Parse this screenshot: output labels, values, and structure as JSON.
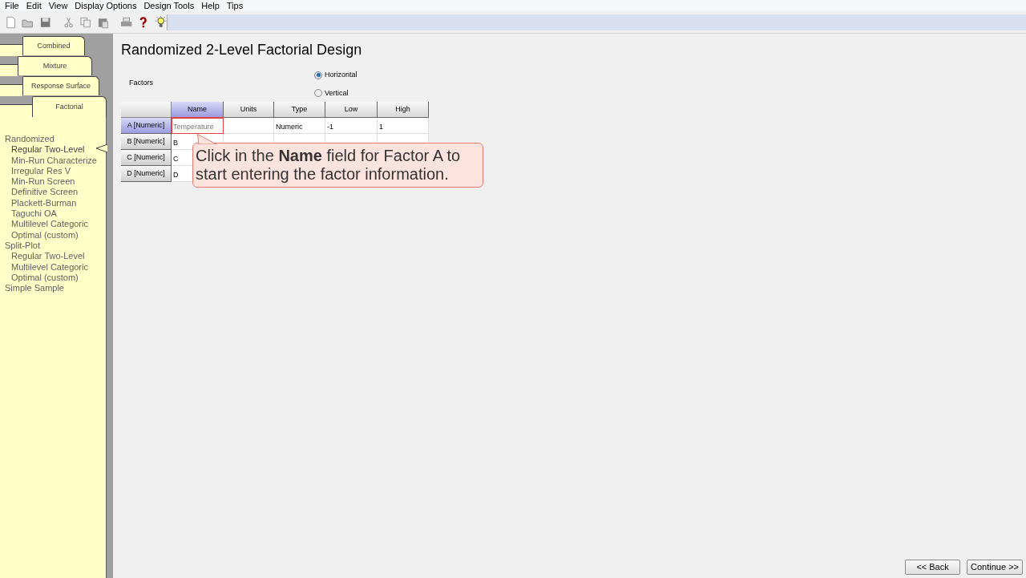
{
  "menu": [
    "File",
    "Edit",
    "View",
    "Display Options",
    "Design Tools",
    "Help",
    "Tips"
  ],
  "toolbar": [
    {
      "kind": "new"
    },
    {
      "kind": "open"
    },
    {
      "kind": "save"
    },
    {
      "kind": "cut"
    },
    {
      "kind": "copy"
    },
    {
      "kind": "paste"
    },
    {
      "kind": "print"
    },
    {
      "kind": "help"
    },
    {
      "kind": "tip"
    }
  ],
  "tabs": [
    {
      "label": "Combined",
      "selected": false
    },
    {
      "label": "Mixture",
      "selected": false
    },
    {
      "label": "Response Surface",
      "selected": false
    },
    {
      "label": "Factorial",
      "selected": true
    }
  ],
  "tree": [
    {
      "label": "Randomized",
      "children": [
        {
          "label": "Regular Two-Level",
          "selected": true
        },
        {
          "label": "Min-Run Characterize",
          "selected": false
        },
        {
          "label": "Irregular Res V",
          "selected": false
        },
        {
          "label": "Min-Run Screen",
          "selected": false
        },
        {
          "label": "Definitive Screen",
          "selected": false
        },
        {
          "label": "Plackett-Burman",
          "selected": false
        },
        {
          "label": "Taguchi OA",
          "selected": false
        },
        {
          "label": "Multilevel Categoric",
          "selected": false
        },
        {
          "label": "Optimal (custom)",
          "selected": false
        }
      ]
    },
    {
      "label": "Split-Plot",
      "children": [
        {
          "label": "Regular Two-Level",
          "selected": false
        },
        {
          "label": "Multilevel Categoric",
          "selected": false
        },
        {
          "label": "Optimal (custom)",
          "selected": false
        }
      ]
    },
    {
      "label": "Simple Sample"
    }
  ],
  "title": "Randomized 2-Level Factorial Design",
  "factors_label": "Factors",
  "orientation": [
    {
      "label": "Horizontal",
      "selected": true
    },
    {
      "label": "Vertical",
      "selected": false
    }
  ],
  "table": {
    "columns": [
      {
        "label": "Name",
        "selected": true
      },
      {
        "label": "Units",
        "selected": false
      },
      {
        "label": "Type",
        "selected": false
      },
      {
        "label": "Low",
        "selected": false
      },
      {
        "label": "High",
        "selected": false
      }
    ],
    "rows": [
      {
        "header": "A [Numeric]",
        "selected": true,
        "cells": [
          "Temperature",
          "",
          "Numeric",
          "-1",
          "1"
        ]
      },
      {
        "header": "B [Numeric]",
        "selected": false,
        "cells": [
          "B",
          "",
          "",
          "",
          ""
        ]
      },
      {
        "header": "C [Numeric]",
        "selected": false,
        "cells": [
          "C",
          "",
          "",
          "",
          ""
        ]
      },
      {
        "header": "D [Numeric]",
        "selected": false,
        "cells": [
          "D",
          "",
          "",
          "",
          ""
        ]
      }
    ]
  },
  "callout": "Click in the **Name** field for Factor A to start entering the factor information.",
  "buttons": [
    "<< Back",
    "Continue >>"
  ]
}
